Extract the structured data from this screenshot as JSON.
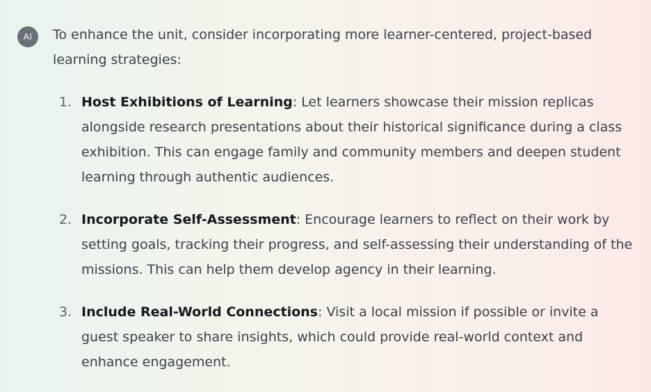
{
  "avatar": {
    "label": "AI"
  },
  "intro": "To enhance the unit, consider incorporating more learner-centered, project-based learning strategies:",
  "items": [
    {
      "number": "1.",
      "title": "Host Exhibitions of Learning",
      "body": ": Let learners showcase their mission replicas alongside research presentations about their historical significance during a class exhibition. This can engage family and community members and deepen student learning through authentic audiences."
    },
    {
      "number": "2.",
      "title": "Incorporate Self-Assessment",
      "body": ": Encourage learners to reflect on their work by setting goals, tracking their progress, and self-assessing their understanding of the missions. This can help them develop agency in their learning."
    },
    {
      "number": "3.",
      "title": "Include Real-World Connections",
      "body": ": Visit a local mission if possible or invite a guest speaker to share insights, which could provide real-world context and enhance engagement."
    }
  ]
}
